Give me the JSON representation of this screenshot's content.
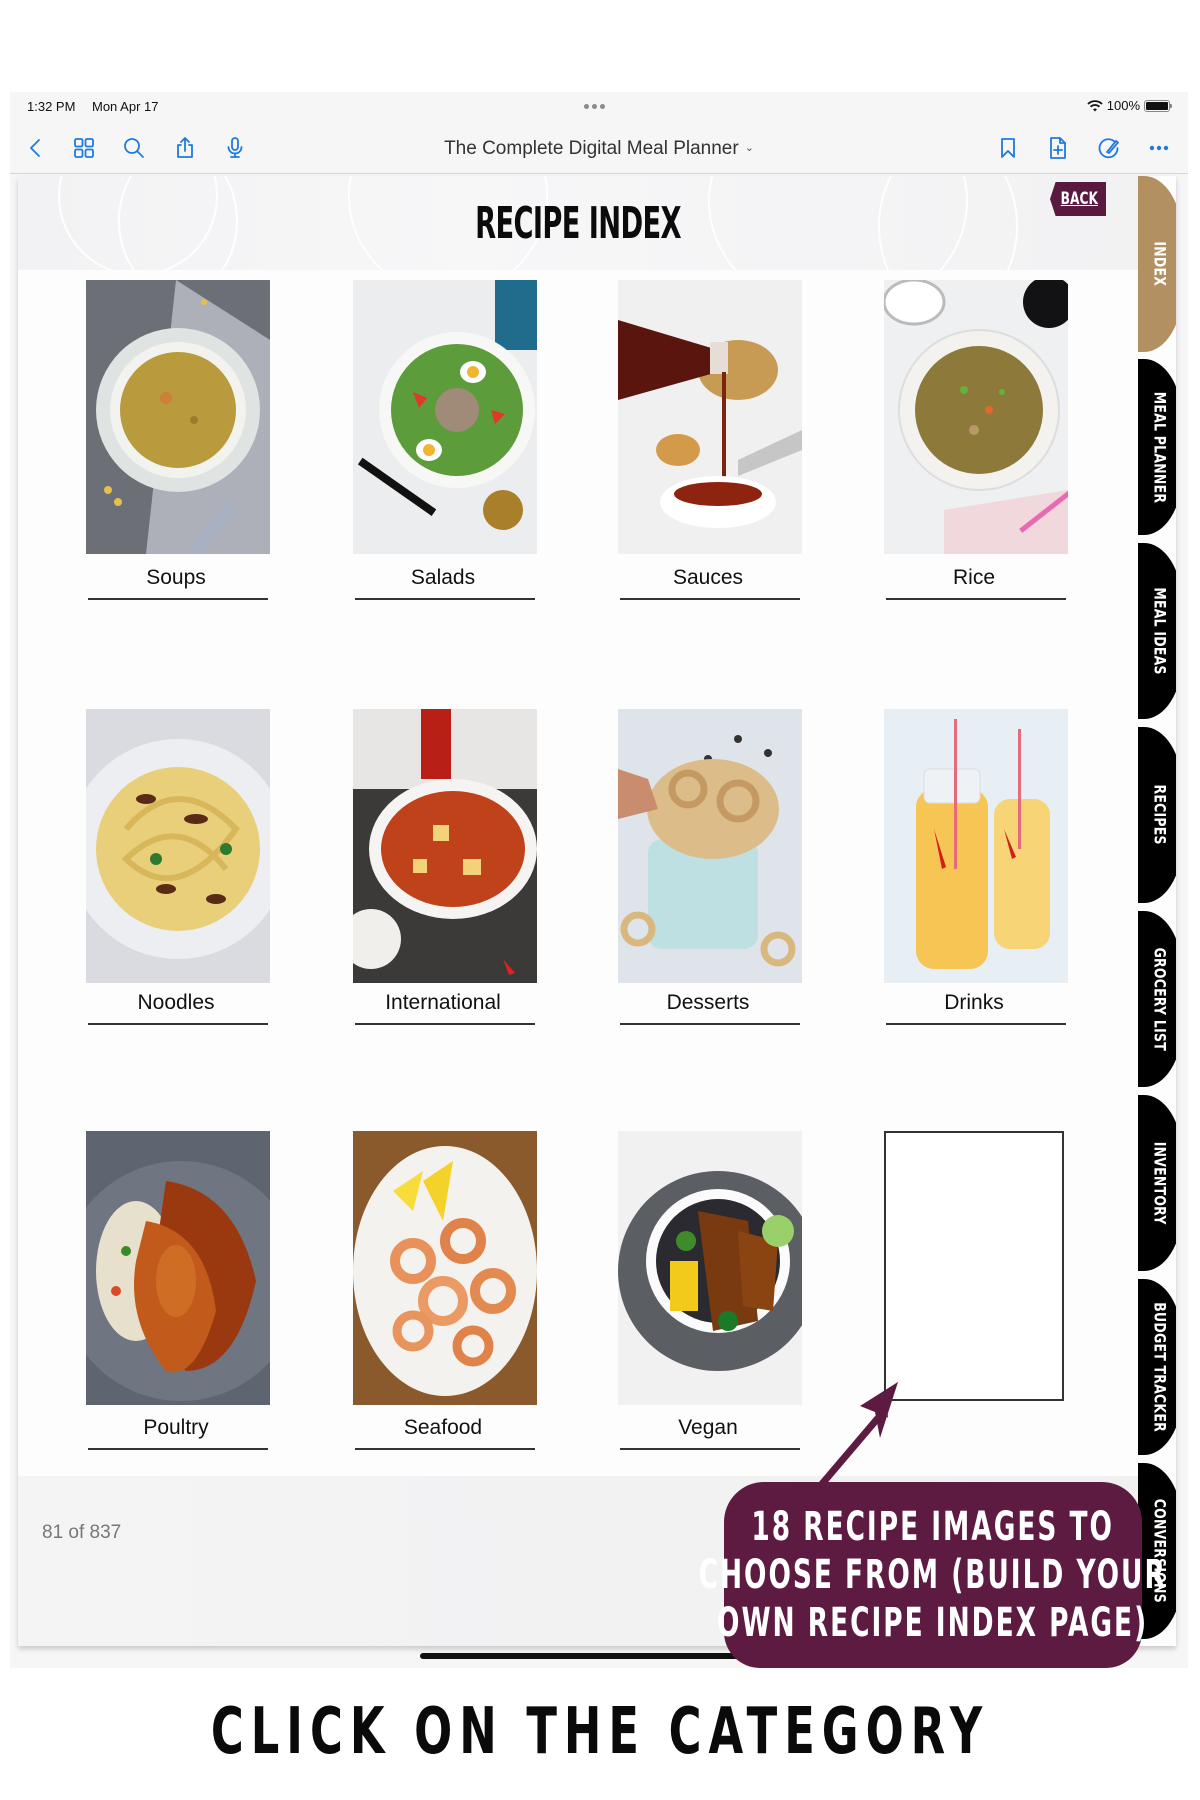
{
  "status_bar": {
    "time": "1:32 PM",
    "date": "Mon Apr 17",
    "battery_percent": "100%",
    "battery_level": 1.0,
    "icons": [
      "wifi-icon",
      "battery-icon"
    ]
  },
  "toolbar": {
    "title": "The Complete Digital Meal Planner",
    "left_icons": [
      "back-chevron-icon",
      "thumbnails-grid-icon",
      "search-icon",
      "share-icon",
      "microphone-icon"
    ],
    "right_icons": [
      "bookmark-icon",
      "add-page-icon",
      "markup-pen-icon",
      "more-icon"
    ]
  },
  "page": {
    "title": "RECIPE INDEX",
    "back_label": "BACK",
    "counter": "81 of 837",
    "categories": [
      {
        "label": "Soups",
        "image": "split pea soup in bowl"
      },
      {
        "label": "Salads",
        "image": "nicoise salad plate"
      },
      {
        "label": "Sauces",
        "image": "sauce poured from bottle"
      },
      {
        "label": "Rice",
        "image": "fried rice bowl"
      },
      {
        "label": "Noodles",
        "image": "spaghetti with mushrooms"
      },
      {
        "label": "International",
        "image": "tofu stew bowl"
      },
      {
        "label": "Desserts",
        "image": "apple chips"
      },
      {
        "label": "Drinks",
        "image": "lemonade bottles"
      },
      {
        "label": "Poultry",
        "image": "glazed chicken breast"
      },
      {
        "label": "Seafood",
        "image": "grilled shrimp with lemon"
      },
      {
        "label": "Vegan",
        "image": "tofu burrito bowl"
      },
      {
        "label": "",
        "image": "empty slot"
      }
    ]
  },
  "side_tabs": [
    {
      "label": "INDEX",
      "active": true
    },
    {
      "label": "MEAL PLANNER",
      "active": false
    },
    {
      "label": "MEAL IDEAS",
      "active": false
    },
    {
      "label": "RECIPES",
      "active": false
    },
    {
      "label": "GROCERY LIST",
      "active": false
    },
    {
      "label": "INVENTORY",
      "active": false
    },
    {
      "label": "BUDGET TRACKER",
      "active": false
    },
    {
      "label": "CONVERSIONS",
      "active": false
    }
  ],
  "callout": {
    "lines": [
      "18 RECIPE IMAGES TO",
      "CHOOSE FROM (BUILD YOUR",
      "OWN RECIPE INDEX PAGE)"
    ]
  },
  "caption": "CLICK ON THE CATEGORY",
  "colors": {
    "accent_blue": "#1f7ae0",
    "plum": "#5d1b42",
    "tab_gold": "#b39062",
    "tab_black": "#000000"
  }
}
